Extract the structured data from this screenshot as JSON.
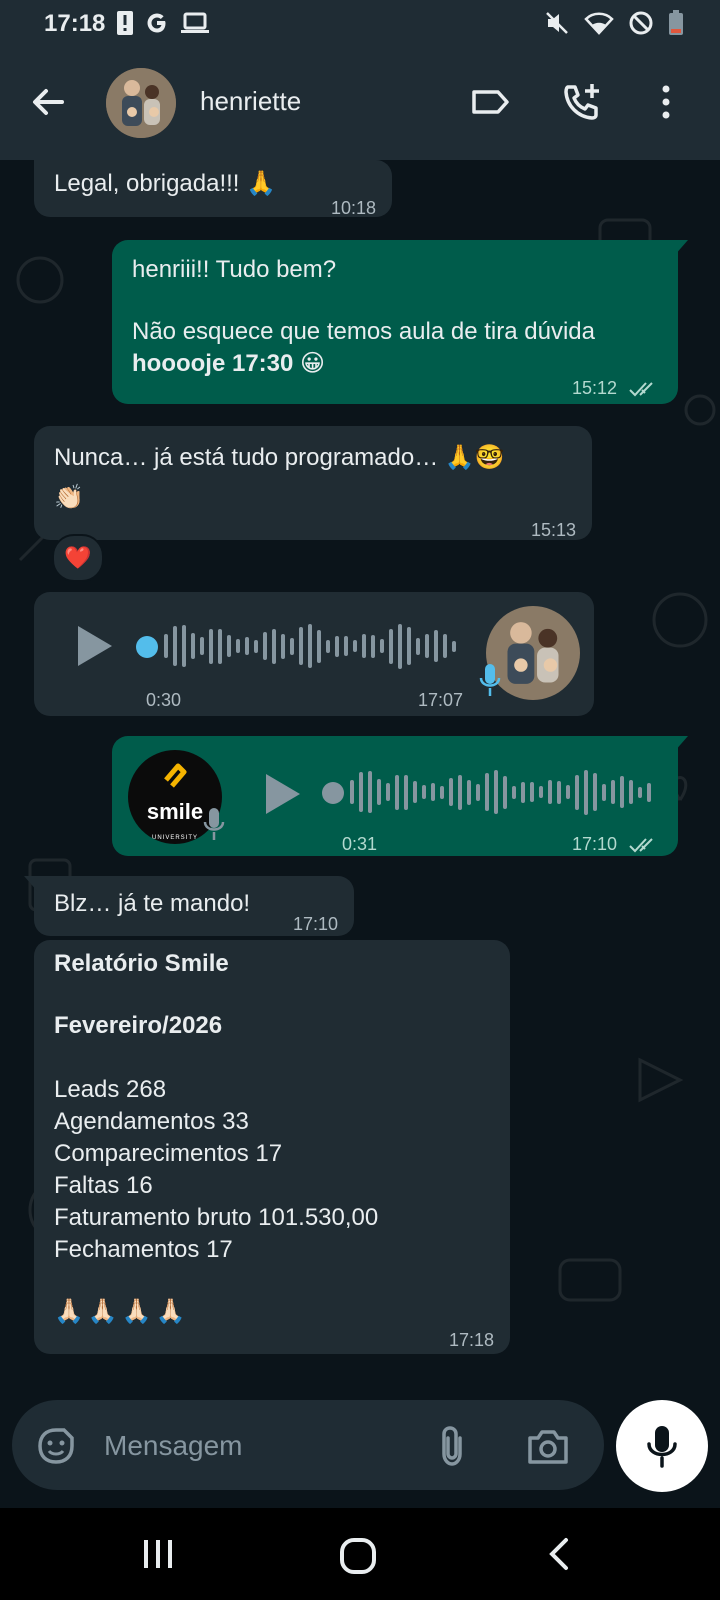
{
  "status_bar": {
    "time": "17:18",
    "left_icons": [
      "alert-icon",
      "google-icon",
      "laptop-icon"
    ],
    "right_icons": [
      "mute-icon",
      "wifi-icon",
      "do-not-disturb-icon",
      "battery-icon"
    ]
  },
  "header": {
    "contact_name": "henriette",
    "icons": [
      "back-arrow-icon",
      "label-icon",
      "add-call-icon",
      "more-options-icon"
    ]
  },
  "messages": [
    {
      "direction": "in",
      "text": "Legal, obrigada!!! 🙏",
      "time": "10:18"
    },
    {
      "direction": "out",
      "line1": "henriii!! Tudo bem?",
      "line2": "Não esquece que temos aula de tira dúvida",
      "line3_bold": "hooooje 17:30",
      "line3_emoji": "😀",
      "time": "15:12",
      "status": "read"
    },
    {
      "direction": "in",
      "text": "Nunca… já está tudo programado… 🙏🤓",
      "text2": "👏🏻",
      "time": "15:13",
      "reaction": "❤️"
    },
    {
      "direction": "in",
      "type": "voice",
      "duration": "0:30",
      "time": "17:07"
    },
    {
      "direction": "out",
      "type": "voice",
      "duration": "0:31",
      "time": "17:10",
      "avatar_text": "smile",
      "avatar_sub": "UNIVERSITY",
      "status": "read"
    },
    {
      "direction": "in",
      "text": "Blz… já te mando!",
      "time": "17:10"
    },
    {
      "direction": "in",
      "title": "Relatório Smile",
      "subtitle": "Fevereiro/2026",
      "lines": [
        "Leads 268",
        "Agendamentos 33",
        "Comparecimentos 17",
        "Faltas 16",
        "Faturamento bruto 101.530,00",
        "Fechamentos 17"
      ],
      "footer": "🙏🏻🙏🏻🙏🏻🙏🏻",
      "time": "17:18"
    }
  ],
  "composer": {
    "placeholder": "Mensagem",
    "icons": [
      "sticker-icon",
      "attach-icon",
      "camera-icon",
      "mic-icon"
    ]
  },
  "colors": {
    "background": "#0b141a",
    "incoming_bubble": "#202c33",
    "outgoing_bubble": "#005c4b",
    "header": "#1f2c34",
    "voice_dot": "#53bdeb"
  }
}
